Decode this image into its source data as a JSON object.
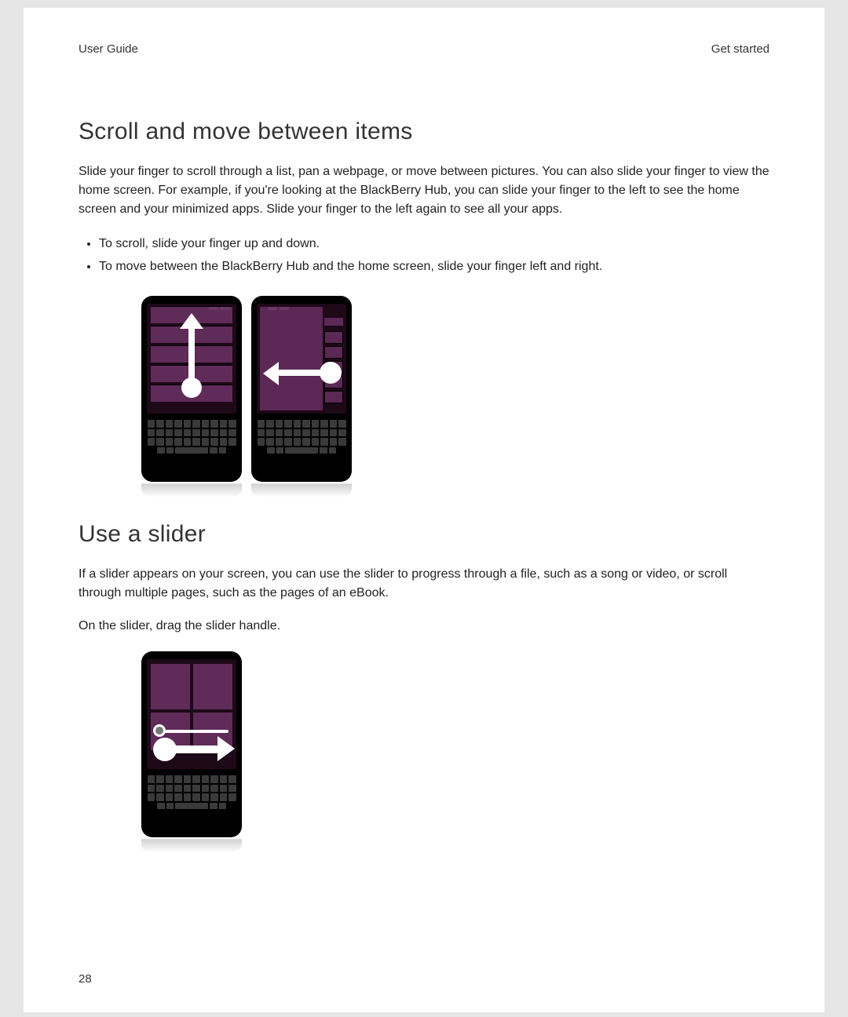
{
  "header": {
    "left": "User Guide",
    "right": "Get started"
  },
  "section1": {
    "title": "Scroll and move between items",
    "intro": "Slide your finger to scroll through a list, pan a webpage, or move between pictures. You can also slide your finger to view the home screen. For example, if you're looking at the BlackBerry Hub, you can slide your finger to the left to see the home screen and your minimized apps. Slide your finger to the left again to see all your apps.",
    "bullets": [
      "To scroll, slide your finger up and down.",
      "To move between the BlackBerry Hub and the home screen, slide your finger left and right."
    ]
  },
  "section2": {
    "title": "Use a slider",
    "intro": "If a slider appears on your screen, you can use the slider to progress through a file, such as a song or video, or scroll through multiple pages, such as the pages of an eBook.",
    "instruction": "On the slider, drag the slider handle."
  },
  "page_number": "28"
}
